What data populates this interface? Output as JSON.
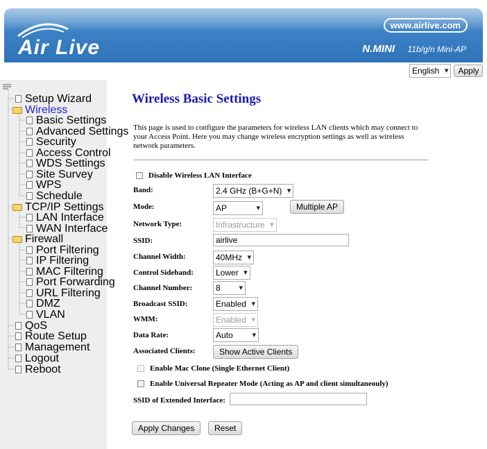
{
  "header": {
    "logo_text": "Air Live",
    "url_text": "www.airlive.com",
    "model_name": "N.MINI",
    "model_desc": "11b/g/n Mini-AP"
  },
  "lang": {
    "selected": "English",
    "apply_label": "Apply"
  },
  "sidebar": {
    "items": [
      {
        "label": "Setup Wizard"
      },
      {
        "label": "Wireless"
      },
      {
        "label": "Basic Settings"
      },
      {
        "label": "Advanced Settings"
      },
      {
        "label": "Security"
      },
      {
        "label": "Access Control"
      },
      {
        "label": "WDS Settings"
      },
      {
        "label": "Site Survey"
      },
      {
        "label": "WPS"
      },
      {
        "label": "Schedule"
      },
      {
        "label": "TCP/IP Settings"
      },
      {
        "label": "LAN Interface"
      },
      {
        "label": "WAN Interface"
      },
      {
        "label": "Firewall"
      },
      {
        "label": "Port Filtering"
      },
      {
        "label": "IP Filtering"
      },
      {
        "label": "MAC Filtering"
      },
      {
        "label": "Port Forwarding"
      },
      {
        "label": "URL Filtering"
      },
      {
        "label": "DMZ"
      },
      {
        "label": "VLAN"
      },
      {
        "label": "QoS"
      },
      {
        "label": "Route Setup"
      },
      {
        "label": "Management"
      },
      {
        "label": "Logout"
      },
      {
        "label": "Reboot"
      }
    ],
    "link_color": "#2222cc"
  },
  "main": {
    "title": "Wireless Basic Settings",
    "description": "This page is used to configure the parameters for wireless LAN clients which may connect to your Access Point. Here you may change wireless encryption settings as well as wireless network parameters.",
    "disable_label": "Disable Wireless LAN Interface",
    "band_label": "Band:",
    "band_value": "2.4 GHz (B+G+N)",
    "mode_label": "Mode:",
    "mode_value": "AP",
    "multiple_ap_label": "Multiple AP",
    "network_type_label": "Network Type:",
    "network_type_value": "Infrastructure",
    "ssid_label": "SSID:",
    "ssid_value": "airlive",
    "channel_width_label": "Channel Width:",
    "channel_width_value": "40MHz",
    "control_sideband_label": "Control Sideband:",
    "control_sideband_value": "Lower",
    "channel_number_label": "Channel Number:",
    "channel_number_value": "8",
    "broadcast_ssid_label": "Broadcast SSID:",
    "broadcast_ssid_value": "Enabled",
    "wmm_label": "WMM:",
    "wmm_value": "Enabled",
    "data_rate_label": "Data Rate:",
    "data_rate_value": "Auto",
    "assoc_label": "Associated Clients:",
    "show_clients_label": "Show Active Clients",
    "mac_clone_label": "Enable Mac Clone (Single Ethernet Client)",
    "repeater_label": "Enable Universal Repeater Mode (Acting as AP and client simultaneouly)",
    "ssid_ext_label": "SSID of Extended Interface:",
    "ssid_ext_value": "",
    "apply_changes_label": "Apply Changes",
    "reset_label": "Reset"
  }
}
